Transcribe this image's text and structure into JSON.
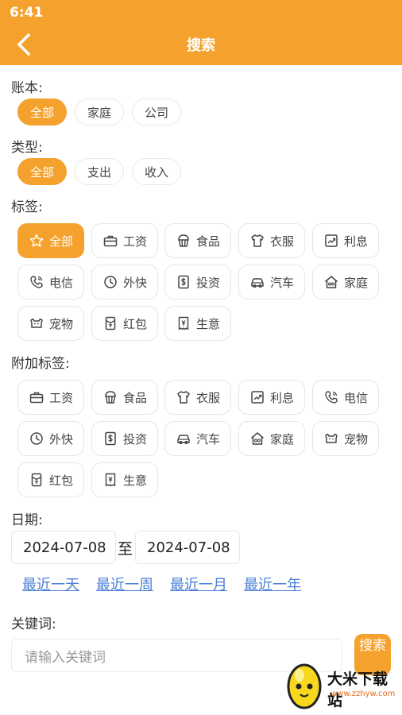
{
  "status_bar": {
    "time": "6:41"
  },
  "app_bar": {
    "title": "搜索"
  },
  "ledger": {
    "label": "账本:",
    "options": [
      "全部",
      "家庭",
      "公司"
    ]
  },
  "type": {
    "label": "类型:",
    "options": [
      "全部",
      "支出",
      "收入"
    ]
  },
  "tags": {
    "label": "标签:",
    "items": [
      {
        "label": "全部",
        "icon": "star-icon"
      },
      {
        "label": "工资",
        "icon": "briefcase-icon"
      },
      {
        "label": "食品",
        "icon": "cupcake-icon"
      },
      {
        "label": "衣服",
        "icon": "shirt-icon"
      },
      {
        "label": "利息",
        "icon": "trend-icon"
      },
      {
        "label": "电信",
        "icon": "phone-icon"
      },
      {
        "label": "外快",
        "icon": "clock-icon"
      },
      {
        "label": "投资",
        "icon": "dollar-icon"
      },
      {
        "label": "汽车",
        "icon": "car-icon"
      },
      {
        "label": "家庭",
        "icon": "home-icon"
      },
      {
        "label": "宠物",
        "icon": "pet-icon"
      },
      {
        "label": "红包",
        "icon": "envelope-icon"
      },
      {
        "label": "生意",
        "icon": "receipt-icon"
      }
    ]
  },
  "extra_tags": {
    "label": "附加标签:",
    "items": [
      {
        "label": "工资",
        "icon": "briefcase-icon"
      },
      {
        "label": "食品",
        "icon": "cupcake-icon"
      },
      {
        "label": "衣服",
        "icon": "shirt-icon"
      },
      {
        "label": "利息",
        "icon": "trend-icon"
      },
      {
        "label": "电信",
        "icon": "phone-icon"
      },
      {
        "label": "外快",
        "icon": "clock-icon"
      },
      {
        "label": "投资",
        "icon": "dollar-icon"
      },
      {
        "label": "汽车",
        "icon": "car-icon"
      },
      {
        "label": "家庭",
        "icon": "home-icon"
      },
      {
        "label": "宠物",
        "icon": "pet-icon"
      },
      {
        "label": "红包",
        "icon": "envelope-icon"
      },
      {
        "label": "生意",
        "icon": "receipt-icon"
      }
    ]
  },
  "date": {
    "label": "日期:",
    "start": "2024-07-08",
    "separator": "至",
    "end": "2024-07-08",
    "quick": [
      "最近一天",
      "最近一周",
      "最近一月",
      "最近一年"
    ]
  },
  "keyword": {
    "label": "关键词:",
    "placeholder": "请输入关键词",
    "button": "搜索"
  },
  "watermark": {
    "name": "大米下载站",
    "url": "www.zzhyw.com"
  },
  "colors": {
    "accent": "#f4a22d",
    "link": "#4a7fd6"
  }
}
